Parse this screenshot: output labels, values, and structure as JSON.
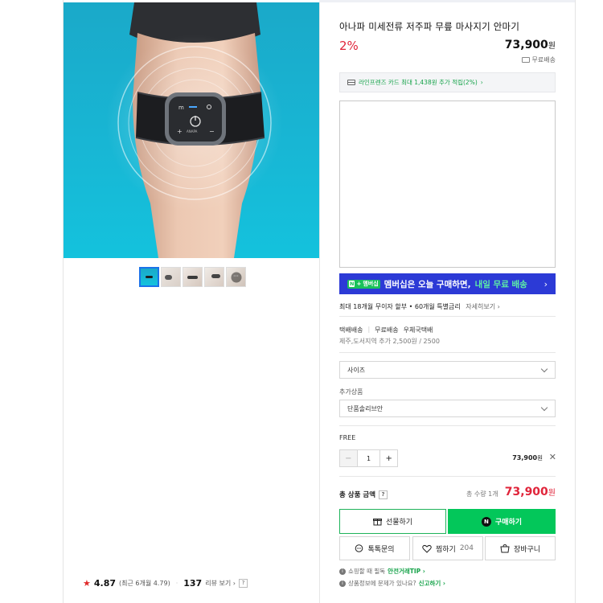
{
  "product": {
    "title": "아나파 미세전류 저주파 무릎 마사지기 안마기",
    "discount": "2%",
    "price": "73,900",
    "price_unit": "원",
    "free_shipping": "무료배송",
    "device_brand": "ANAPA"
  },
  "card_benefit": {
    "text": "라인프렌즈 카드 최대 1,438원 추가 적립(2%)",
    "chevron": "›"
  },
  "membership": {
    "badge_n": "N",
    "badge_plus": "+",
    "badge_text": "멤버십",
    "text_prefix": "멤버십은 오늘 구매하면,",
    "text_highlight": "내일 무료 배송",
    "chevron": "›"
  },
  "installment": {
    "text": "최대 18개월 무이자 할부 • 60개월 특별금리",
    "more": "자세히보기 ›"
  },
  "shipping": {
    "items": [
      "택배배송",
      "무료배송",
      "우체국택배"
    ],
    "note": "제주,도서지역 추가 2,500원 / 2500"
  },
  "options": {
    "size_placeholder": "사이즈",
    "addon_label": "추가상품",
    "addon_value": "단품솔리브안"
  },
  "selected_item": {
    "label": "FREE",
    "minus": "−",
    "quantity": "1",
    "plus": "+",
    "price": "73,900",
    "price_unit": "원",
    "remove": "✕"
  },
  "total": {
    "label": "총 상품 금액",
    "help": "?",
    "count": "총 수량 1개",
    "price": "73,900",
    "price_unit": "원"
  },
  "buttons": {
    "gift": "선물하기",
    "buy_badge": "N",
    "buy": "구매하기",
    "talk": "톡톡문의",
    "wish": "찜하기",
    "wish_count": "204",
    "cart": "장바구니"
  },
  "notices": [
    {
      "icon": "i",
      "text": "쇼핑할 때 필독",
      "link": "안전거래TIP ›"
    },
    {
      "icon": "i",
      "text": "상품정보에 문제가 있나요?",
      "link": "신고하기 ›"
    }
  ],
  "thumbnails": {
    "more": "···"
  },
  "rating": {
    "star": "★",
    "score": "4.87",
    "recent": "(최근 6개월 4.79)",
    "separator": "·",
    "review_count": "137",
    "review_label": "리뷰 보기 ›",
    "help": "?"
  },
  "colors": {
    "accent_red": "#e0243a",
    "naver_green": "#03c75a",
    "membership_blue": "#2c3ad6"
  }
}
